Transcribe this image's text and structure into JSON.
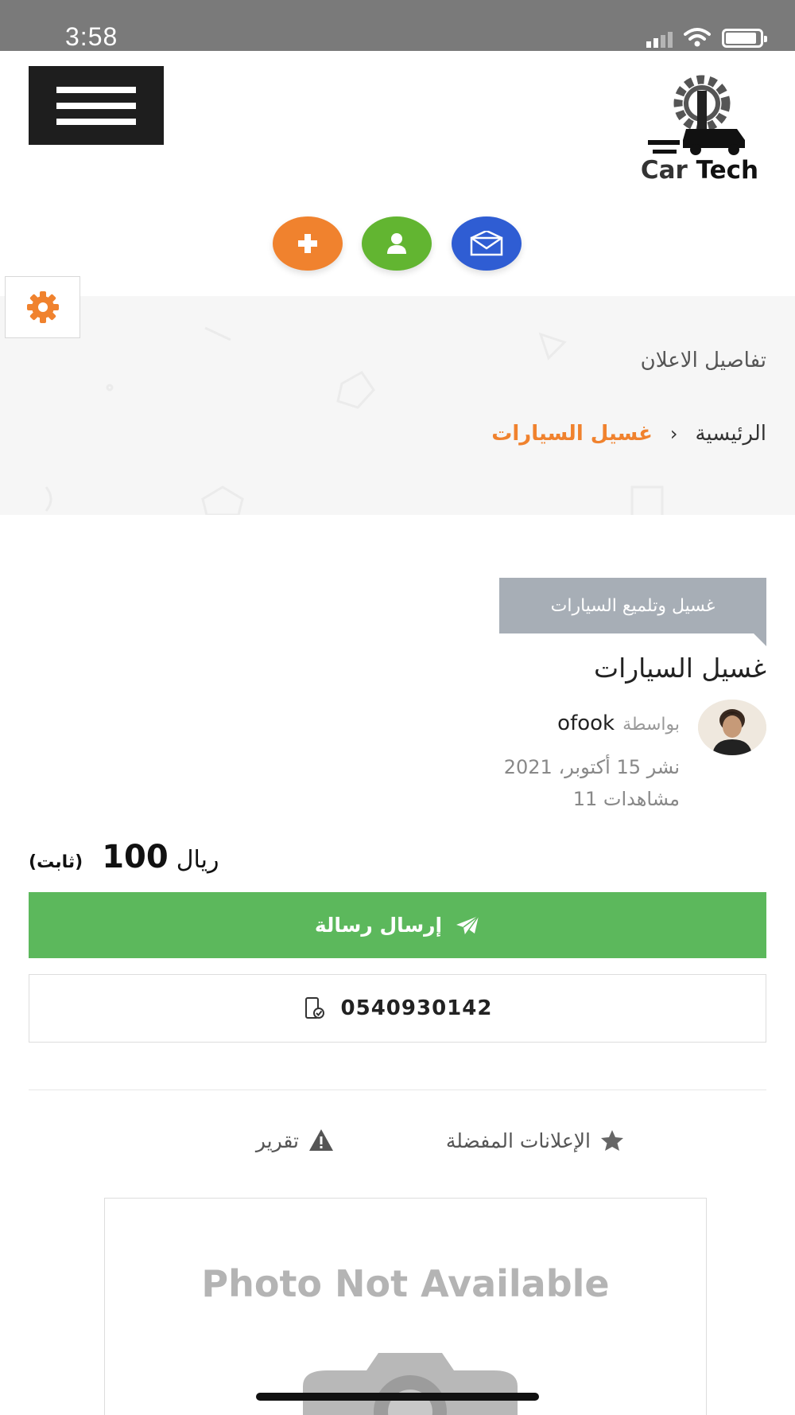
{
  "status_bar": {
    "time": "3:58"
  },
  "header": {
    "logo_text_a": "Car",
    "logo_text_b": "Tech"
  },
  "hero": {
    "title": "تفاصيل الاعلان",
    "breadcrumb": {
      "home": "الرئيسية",
      "separator": "‹",
      "current": "غسيل السيارات"
    }
  },
  "listing": {
    "category": "غسيل وتلميع السيارات",
    "title": "غسيل السيارات",
    "by_label": "بواسطة",
    "author": "ofook",
    "published": "نشر 15 أكتوبر، 2021",
    "views": "مشاهدات 11",
    "price": {
      "currency": "ريال",
      "amount": "100",
      "type": "(ثابت)"
    },
    "send_button": "إرسال رسالة",
    "phone": "0540930142",
    "favorites_label": "الإعلانات المفضلة",
    "report_label": "تقرير",
    "photo_placeholder": "Photo Not Available"
  },
  "colors": {
    "orange": "#f0822e",
    "green": "#62b531",
    "blue": "#2f5dd3",
    "send_green": "#5cb85c",
    "tag_gray": "#a7aeb6"
  }
}
